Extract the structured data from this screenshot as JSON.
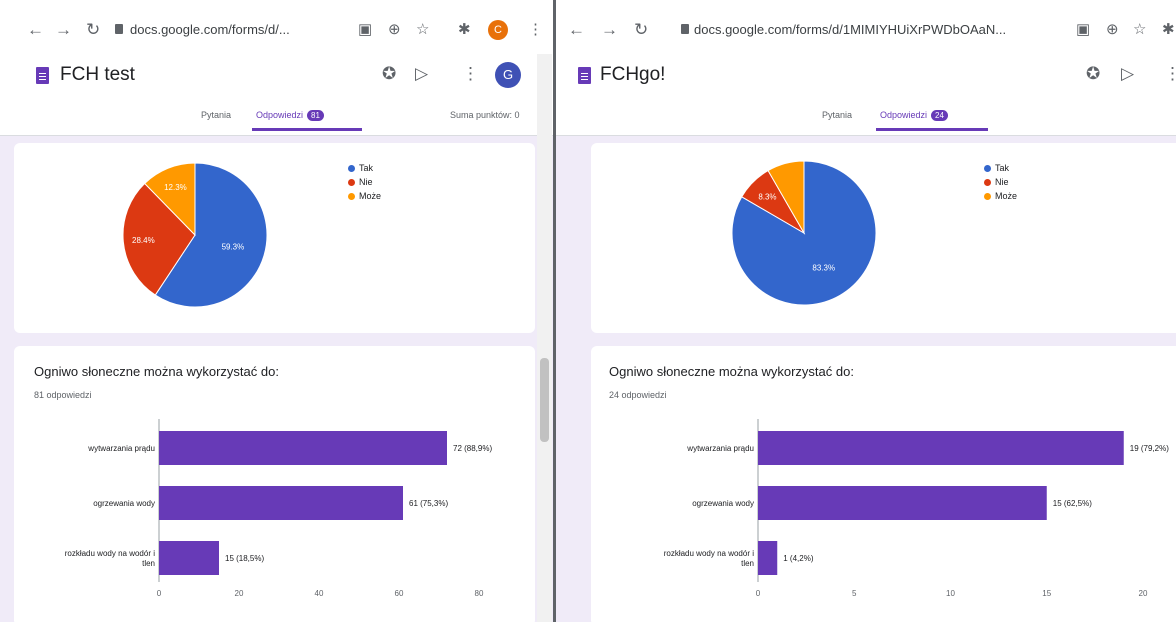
{
  "left": {
    "browser": {
      "url": "docs.google.com/forms/d/...",
      "profile_initial": "C"
    },
    "form": {
      "title": "FCH test",
      "tab_questions": "Pytania",
      "tab_responses": "Odpowiedzi",
      "responses_badge": "81",
      "score_text": "Suma punktów: 0",
      "avatar_initial": "G"
    },
    "pie": {
      "legend": [
        "Tak",
        "Nie",
        "Może"
      ],
      "labels": [
        "59.3%",
        "28.4%",
        "12.3%"
      ]
    },
    "question": {
      "title": "Ogniwo słoneczne można wykorzystać do:",
      "responses": "81 odpowiedzi",
      "categories": [
        "wytwarzania prądu",
        "ogrzewania wody",
        "rozkładu wody na wodór i tlen"
      ],
      "value_labels": [
        "72 (88,9%)",
        "61 (75,3%)",
        "15 (18,5%)"
      ],
      "ticks": [
        "0",
        "20",
        "40",
        "60",
        "80"
      ]
    }
  },
  "right": {
    "browser": {
      "url": "docs.google.com/forms/d/1MIMIYHUiXrPWDbOAaN..."
    },
    "form": {
      "title": "FCHgo!",
      "tab_questions": "Pytania",
      "tab_responses": "Odpowiedzi",
      "responses_badge": "24"
    },
    "pie": {
      "legend": [
        "Tak",
        "Nie",
        "Może"
      ],
      "labels": [
        "83.3%",
        "8.3%"
      ]
    },
    "question": {
      "title": "Ogniwo słoneczne można wykorzystać do:",
      "responses": "24 odpowiedzi",
      "categories": [
        "wytwarzania prądu",
        "ogrzewania wody",
        "rozkładu wody na wodór i tlen"
      ],
      "value_labels": [
        "19 (79,2%)",
        "15 (62,5%)",
        "1 (4,2%)"
      ],
      "ticks": [
        "0",
        "5",
        "10",
        "15",
        "20"
      ]
    }
  },
  "colors": {
    "tak": "#3366cc",
    "nie": "#dc3912",
    "moze": "#ff9900",
    "bar": "#673ab7",
    "accent": "#673ab7"
  },
  "icons": {
    "back": "arrow-left-icon",
    "forward": "arrow-right-icon",
    "reload": "reload-icon",
    "palette": "palette-icon",
    "send": "send-icon",
    "more": "more-vert-icon"
  },
  "chart_data": [
    {
      "type": "pie",
      "title": "",
      "categories": [
        "Tak",
        "Nie",
        "Może"
      ],
      "values": [
        59.3,
        28.4,
        12.3
      ],
      "legend": "top-right"
    },
    {
      "type": "bar",
      "orientation": "horizontal",
      "title": "Ogniwo słoneczne można wykorzystać do:",
      "categories": [
        "wytwarzania prądu",
        "ogrzewania wody",
        "rozkładu wody na wodór i tlen"
      ],
      "values": [
        72,
        61,
        15
      ],
      "xlim": [
        0,
        80
      ]
    },
    {
      "type": "pie",
      "title": "",
      "categories": [
        "Tak",
        "Nie",
        "Może"
      ],
      "values": [
        83.3,
        8.3,
        8.3
      ],
      "legend": "top-right"
    },
    {
      "type": "bar",
      "orientation": "horizontal",
      "title": "Ogniwo słoneczne można wykorzystać do:",
      "categories": [
        "wytwarzania prądu",
        "ogrzewania wody",
        "rozkładu wody na wodór i tlen"
      ],
      "values": [
        19,
        15,
        1
      ],
      "xlim": [
        0,
        20
      ]
    }
  ]
}
